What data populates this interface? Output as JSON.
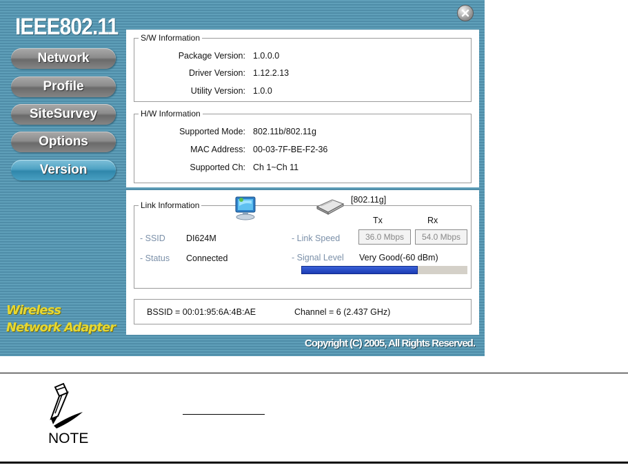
{
  "app": {
    "brand": "IEEE802.11",
    "nav": [
      {
        "label": "Network"
      },
      {
        "label": "Profile"
      },
      {
        "label": "SiteSurvey"
      },
      {
        "label": "Options"
      },
      {
        "label": "Version",
        "active": true
      }
    ],
    "tagline": [
      "Wireless",
      "Network Adapter"
    ],
    "copyright": "Copyright (C) 2005, All Rights Reserved.",
    "colors": {
      "accent": "#4ea2c3",
      "background": "#5a98b3",
      "tagline": "#e8d830",
      "signal_bar": "#2a4fcb"
    }
  },
  "sw_info": {
    "legend": "S/W Information",
    "rows": [
      {
        "label": "Package Version:",
        "value": "1.0.0.0"
      },
      {
        "label": "Driver Version:",
        "value": "1.12.2.13"
      },
      {
        "label": "Utility Version:",
        "value": "1.0.0"
      }
    ]
  },
  "hw_info": {
    "legend": "H/W Information",
    "rows": [
      {
        "label": "Supported Mode:",
        "value": "802.11b/802.11g"
      },
      {
        "label": "MAC Address:",
        "value": "00-03-7F-BE-F2-36"
      },
      {
        "label": "Supported Ch:",
        "value": "Ch 1~Ch 11"
      }
    ]
  },
  "link_info": {
    "legend": "Link Information",
    "mode": "[802.11g]",
    "ssid_label": "- SSID",
    "ssid": "DI624M",
    "status_label": "- Status",
    "status": "Connected",
    "tx_header": "Tx",
    "rx_header": "Rx",
    "link_speed_label": "- Link Speed",
    "tx_speed": "36.0 Mbps",
    "rx_speed": "54.0 Mbps",
    "signal_label": "- Signal Level",
    "signal_text": "Very Good(-60 dBm)",
    "signal_percent": 70,
    "bssid": "BSSID = 00:01:95:6A:4B:AE",
    "channel": "Channel = 6 (2.437 GHz)"
  },
  "note": {
    "label": "NOTE"
  }
}
